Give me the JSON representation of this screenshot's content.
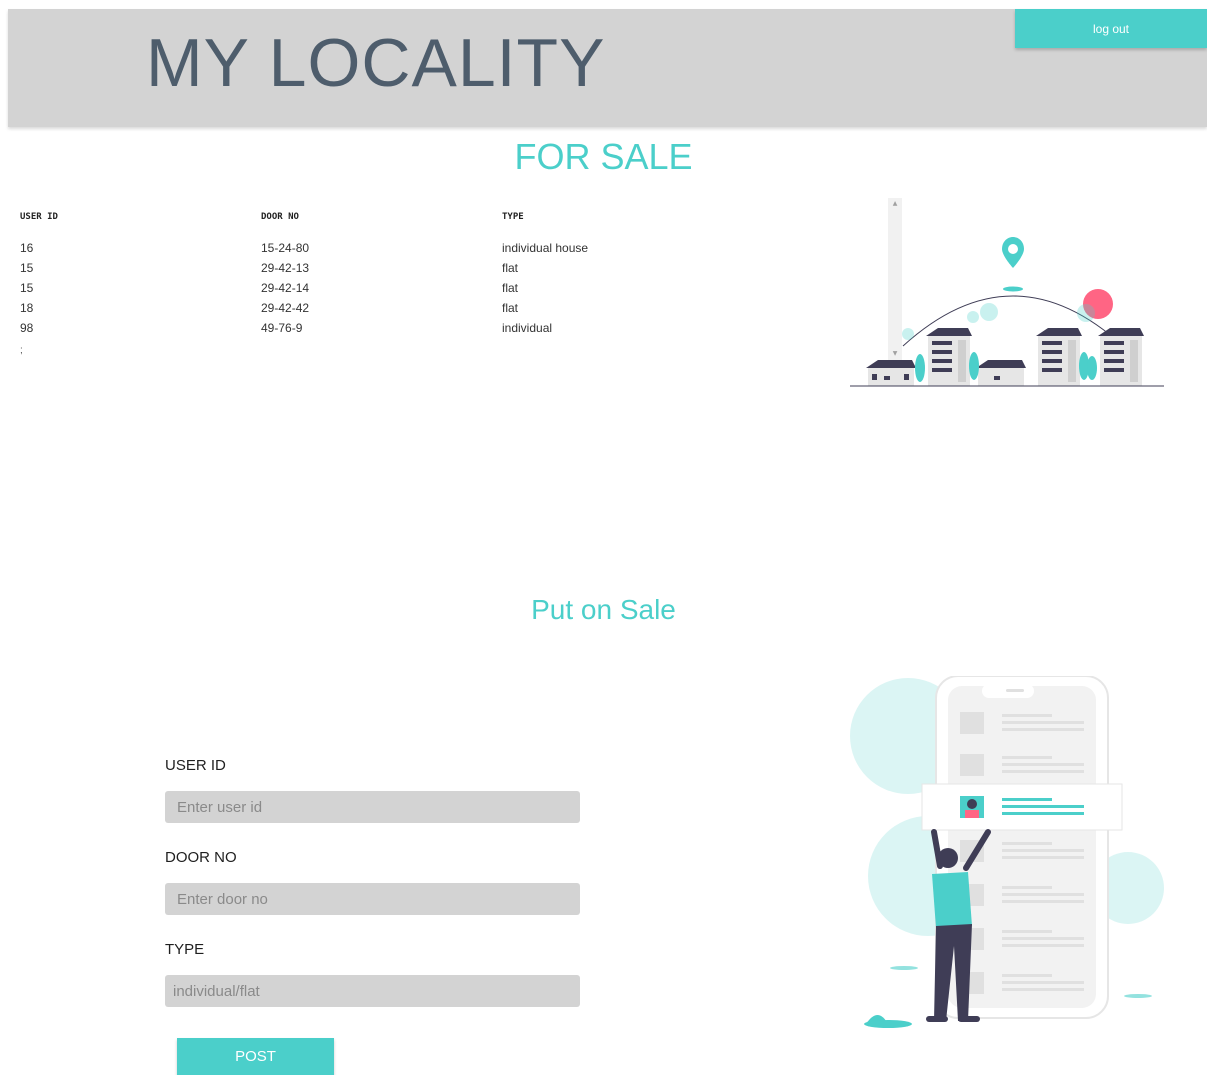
{
  "header": {
    "title": "MY LOCALITY",
    "logout_label": "log out"
  },
  "for_sale": {
    "title": "FOR SALE",
    "columns": [
      "USER ID",
      "DOOR NO",
      "TYPE"
    ],
    "rows": [
      [
        "16",
        "15-24-80",
        "individual house"
      ],
      [
        "15",
        "29-42-13",
        "flat"
      ],
      [
        "15",
        "29-42-14",
        "flat"
      ],
      [
        "18",
        "29-42-42",
        "flat"
      ],
      [
        "98",
        "49-76-9",
        "individual"
      ]
    ],
    "stray_text": ";"
  },
  "put_on_sale": {
    "title": "Put on Sale",
    "user_id_label": "USER ID",
    "user_id_placeholder": "Enter user id",
    "door_no_label": "DOOR NO",
    "door_no_placeholder": "Enter door no",
    "type_label": "TYPE",
    "type_placeholder": "individual/flat",
    "post_label": "POST"
  },
  "colors": {
    "accent": "#4bcfca",
    "header_bg": "#d3d3d3",
    "title_text": "#4e5d6c",
    "input_bg": "#d3d3d3",
    "building_dark": "#3f3d56",
    "pin_accent": "#ff6584"
  },
  "icons": [
    "city-illustration",
    "location-pin-icon",
    "phone-illustration",
    "person-illustration",
    "avatar-icon"
  ]
}
